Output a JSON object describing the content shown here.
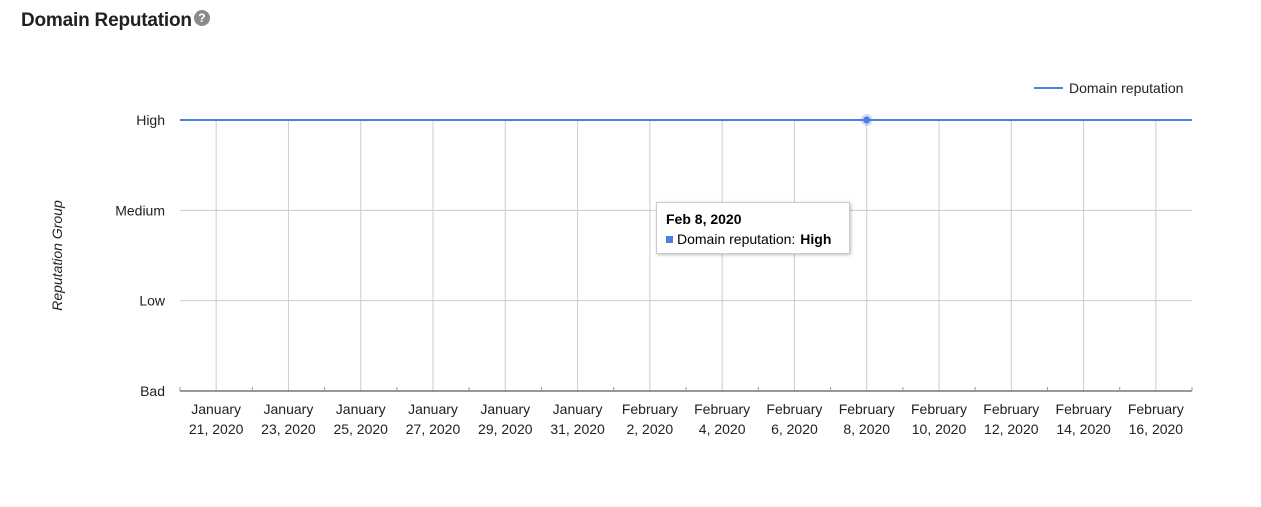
{
  "header": {
    "title": "Domain Reputation",
    "help_icon": "?"
  },
  "chart_data": {
    "type": "line",
    "ylabel": "Reputation Group",
    "y_categories": [
      "Bad",
      "Low",
      "Medium",
      "High"
    ],
    "x_tick_labels": [
      [
        "January",
        "21, 2020"
      ],
      [
        "January",
        "23, 2020"
      ],
      [
        "January",
        "25, 2020"
      ],
      [
        "January",
        "27, 2020"
      ],
      [
        "January",
        "29, 2020"
      ],
      [
        "January",
        "31, 2020"
      ],
      [
        "February",
        "2, 2020"
      ],
      [
        "February",
        "4, 2020"
      ],
      [
        "February",
        "6, 2020"
      ],
      [
        "February",
        "8, 2020"
      ],
      [
        "February",
        "10, 2020"
      ],
      [
        "February",
        "12, 2020"
      ],
      [
        "February",
        "14, 2020"
      ],
      [
        "February",
        "16, 2020"
      ]
    ],
    "series": [
      {
        "name": "Domain reputation",
        "color": "#4a7fe6",
        "value": "High",
        "x_range": [
          "2020-01-20",
          "2020-02-17"
        ]
      }
    ],
    "highlighted_point": {
      "x": "2020-02-08",
      "y": "High"
    },
    "legend": {
      "position": "top-right"
    },
    "grid": true
  },
  "tooltip": {
    "date": "Feb 8, 2020",
    "series_label": "Domain reputation:",
    "value": "High"
  }
}
